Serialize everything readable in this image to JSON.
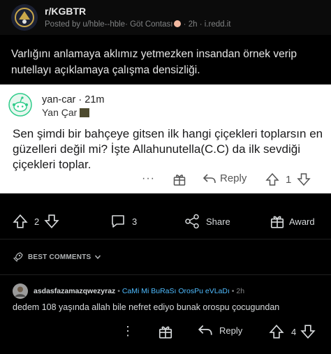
{
  "post": {
    "subreddit": "r/KGBTR",
    "posted_by": "Posted by u/hble--hble",
    "user_flair": "Göt Contası",
    "time": "2h",
    "domain": "i.redd.it",
    "title": "Varlığını anlamaya aklımız yetmezken insandan örnek verip nutellayı açıklamaya çalışma densizliği."
  },
  "embedded_comment": {
    "username": "yan-car",
    "time": "21m",
    "flair": "Yan Çar",
    "body": "Sen şimdi bir bahçeye gitsen ilk hangi çiçekleri toplarsın en güzelleri değil mi? İşte Allahunutella(C.C) da ilk sevdiği çiçekleri toplar.",
    "more_label": "···",
    "reply_label": "Reply",
    "score": "1"
  },
  "post_actions": {
    "score": "2",
    "comments": "3",
    "share_label": "Share",
    "award_label": "Award"
  },
  "sort": {
    "label": "BEST COMMENTS"
  },
  "comment": {
    "username": "asdasfazamazqwezyraz",
    "flair": "CaMi Mi BuRaSı OrosPu eVLaDı",
    "time": "2h",
    "body": "dedem 108 yaşında allah bile nefret ediyo bunak orospu çocugundan",
    "more_label": "⋮",
    "reply_label": "Reply",
    "score": "4"
  },
  "colors": {
    "background": "#000000",
    "flair_blue": "#4fbcff",
    "card_bg": "#ffffff",
    "muted": "#818384"
  }
}
